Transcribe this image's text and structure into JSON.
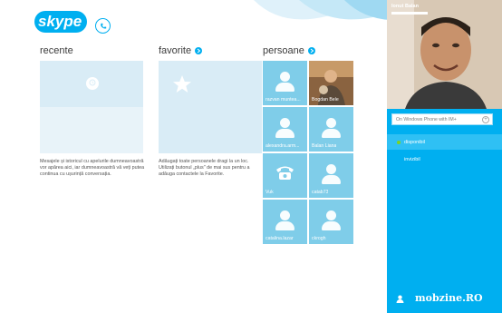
{
  "app": {
    "logo_text": "skype"
  },
  "sections": {
    "recent": {
      "title": "recente",
      "description": "Mesajele și istoricul cu apelurile dumneavoastră vor apărea aici, iar dumneavoastră vă veți putea continua cu ușurință conversația."
    },
    "favorites": {
      "title": "favorite",
      "description": "Adăugați toate persoanele dragi la un loc. Utilizați butonul „plus\" de mai sus pentru a adăuga contactele la Favorite."
    },
    "people": {
      "title": "persoane"
    }
  },
  "contacts": [
    {
      "name": "razvan munteа..."
    },
    {
      "name": "Bogdan Bele"
    },
    {
      "name": "alexandra.arm..."
    },
    {
      "name": "Balan Liana"
    },
    {
      "name": "Vuk"
    },
    {
      "name": "catab73"
    },
    {
      "name": "catalina.lazar"
    },
    {
      "name": "ckrogh"
    }
  ],
  "profile": {
    "name": "Ionut Balan",
    "status_placeholder": "On Windows Phone with IM+",
    "status_options": [
      {
        "label": "disponibil",
        "selected": true,
        "color": "#7ed321"
      },
      {
        "label": "invizibil",
        "selected": false
      }
    ]
  },
  "watermark": "mobzine.RO",
  "colors": {
    "accent": "#00aff0",
    "tile": "#7fcde9",
    "tile_light": "#d9ecf6"
  }
}
